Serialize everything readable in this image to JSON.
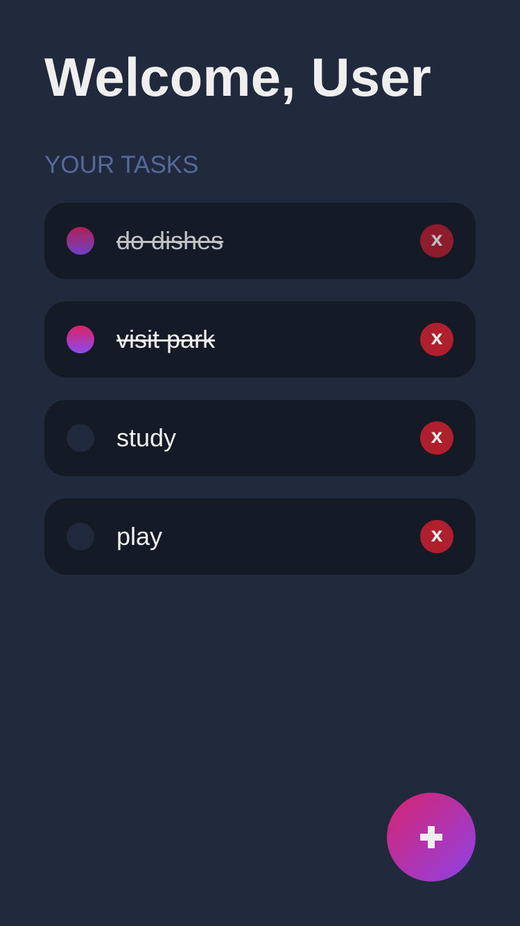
{
  "header": {
    "title": "Welcome, User",
    "subtitle": "YOUR TASKS"
  },
  "tasks": [
    {
      "label": "do dishes",
      "done": true,
      "delete_label": "x"
    },
    {
      "label": "visit park",
      "done": true,
      "delete_label": "x"
    },
    {
      "label": "study",
      "done": false,
      "delete_label": "x"
    },
    {
      "label": "play",
      "done": false,
      "delete_label": "x"
    }
  ],
  "fab": {
    "icon": "plus-icon"
  },
  "colors": {
    "background": "#202a3c",
    "card": "#141a26",
    "delete": "#b01f2e",
    "accent_start": "#dd2265",
    "accent_end": "#8b4bf0"
  }
}
